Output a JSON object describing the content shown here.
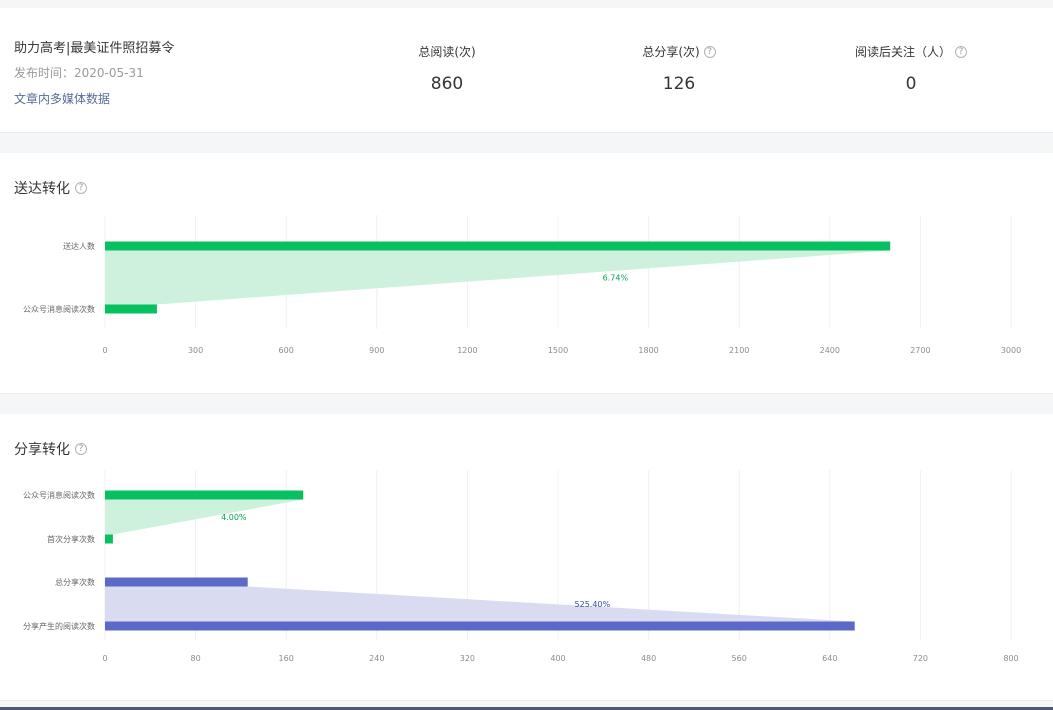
{
  "article": {
    "title": "助力高考|最美证件照招募令",
    "date": "发布时间：2020-05-31",
    "link": "文章内多媒体数据"
  },
  "stats": [
    {
      "label": "总阅读(次)",
      "value": "860",
      "help": false
    },
    {
      "label": "总分享(次)",
      "value": "126",
      "help": true
    },
    {
      "label": "阅读后关注（人）",
      "value": "0",
      "help": true
    }
  ],
  "help_icon": "?",
  "colors": {
    "green": "#07c160",
    "green_fill": "#cdf1dc",
    "blue": "#5b6ac8",
    "blue_fill": "#d9dcf0"
  },
  "chart_data": [
    {
      "type": "bar",
      "title": "送达转化",
      "categories": [
        "送达人数",
        "公众号消息阅读次数"
      ],
      "values": [
        2600,
        172
      ],
      "conversions": [
        {
          "label": "6.74%",
          "from": 0,
          "to": 1
        }
      ],
      "xlim": [
        0,
        3000
      ],
      "xticks": [
        "0",
        "300",
        "600",
        "900",
        "1200",
        "1500",
        "1800",
        "2100",
        "2400",
        "2700",
        "3000"
      ],
      "grid": true
    },
    {
      "type": "bar",
      "title": "分享转化",
      "categories": [
        "公众号消息阅读次数",
        "首次分享次数",
        "总分享次数",
        "分享产生的阅读次数"
      ],
      "values": [
        175,
        7,
        126,
        662
      ],
      "conversions": [
        {
          "label": "4.00%",
          "from": 0,
          "to": 1
        },
        {
          "label": "525.40%",
          "from": 2,
          "to": 3
        }
      ],
      "xlim": [
        0,
        800
      ],
      "xticks": [
        "0",
        "80",
        "160",
        "240",
        "320",
        "400",
        "480",
        "560",
        "640",
        "720",
        "800"
      ],
      "grid": true
    }
  ]
}
